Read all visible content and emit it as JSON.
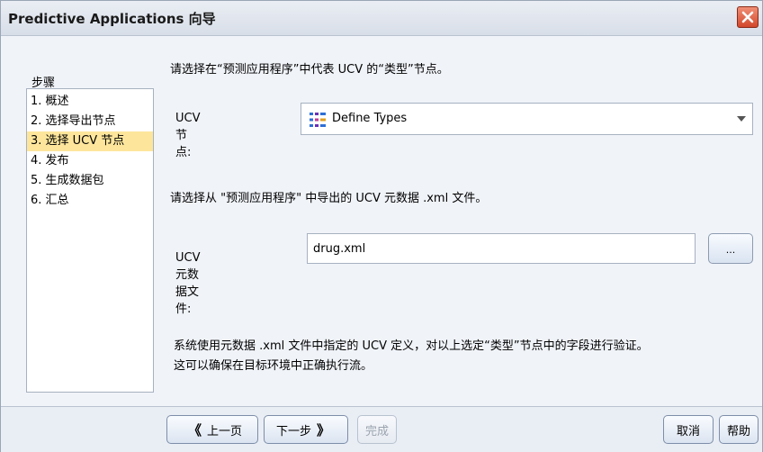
{
  "window": {
    "title": "Predictive Applications 向导"
  },
  "sidebar": {
    "label": "步骤",
    "items": [
      {
        "label": "1. 概述"
      },
      {
        "label": "2. 选择导出节点"
      },
      {
        "label": "3. 选择 UCV 节点",
        "active": true
      },
      {
        "label": "4. 发布"
      },
      {
        "label": "5. 生成数据包"
      },
      {
        "label": "6. 汇总"
      }
    ]
  },
  "main": {
    "instruction_1": "请选择在“预测应用程序”中代表 UCV 的“类型”节点。",
    "ucv_node": {
      "label": "UCV 节点:",
      "value": "Define Types",
      "icon": "type-node-icon"
    },
    "instruction_2": "请选择从 \"预测应用程序\" 中导出的 UCV 元数据 .xml 文件。",
    "metadata_file": {
      "label": "UCV 元数据文件:",
      "value": "drug.xml"
    },
    "browse_label": "...",
    "note_line_1": "系统使用元数据 .xml 文件中指定的 UCV 定义，对以上选定“类型”节点中的字段进行验证。",
    "note_line_2": "这可以确保在目标环境中正确执行流。"
  },
  "footer": {
    "back_label": "上一页",
    "next_label": "下一步",
    "finish_label": "完成",
    "cancel_label": "取消",
    "help_label": "帮助"
  },
  "colors": {
    "active_step": "#fde69c",
    "close_button": "#d2472b",
    "window_bg": "#f0f3f8"
  }
}
